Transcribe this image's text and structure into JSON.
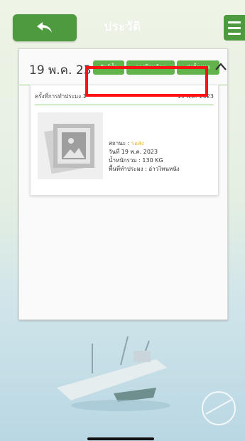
{
  "header": {
    "title": "ประวัติ"
  },
  "record_group": {
    "date": "19 พ.ค. 23",
    "tags": [
      "สัตว์น้ำ",
      "การโอนย้าย",
      "ส่งทั้งหมด"
    ]
  },
  "record_card": {
    "title": "ครั้งที่การทำประมง.1",
    "date": "19 พ.ค. 2023",
    "status_label": "สถานะ : ",
    "status_value": "รอส่ง",
    "date_line": "วันที่ 19 พ.ค. 2023",
    "total_weight": "น้ำหนักรวม : 130 KG",
    "fishing_area": "พื้นที่ทำประมง : อ่าวไทนหนัง"
  },
  "colors": {
    "accent_green": "#4e9a3f",
    "tag_green": "#63b34d",
    "status_yellow": "#e8b331",
    "highlight_red": "#ff1111"
  },
  "icons": {
    "back": "back-arrow-icon",
    "menu": "hamburger-menu-icon",
    "collapse": "chevron-up-icon",
    "thumbnail": "image-placeholder-icon"
  }
}
